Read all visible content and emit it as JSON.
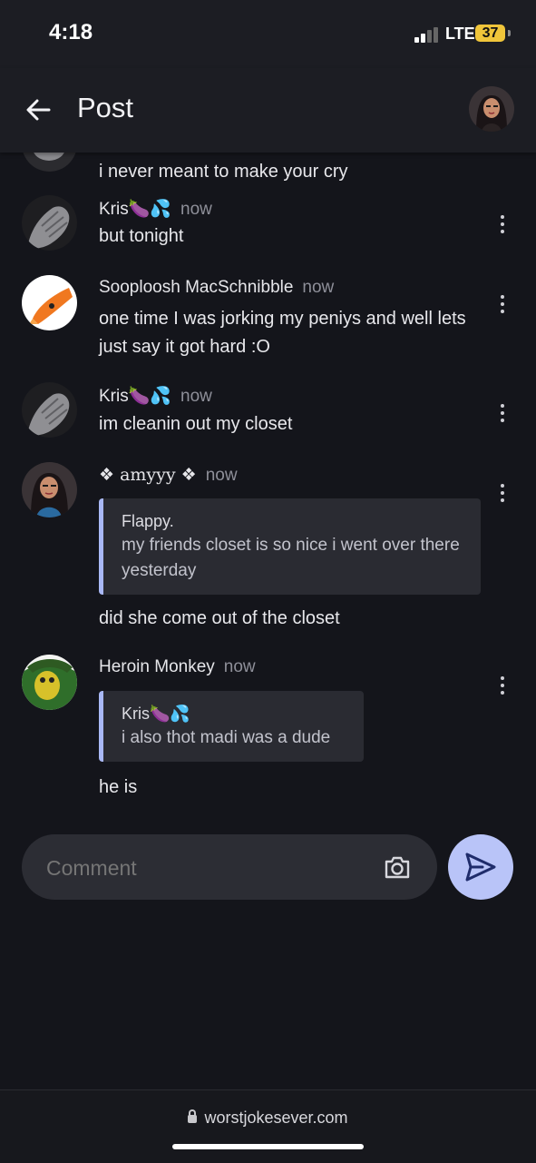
{
  "status": {
    "time": "4:18",
    "network": "LTE",
    "battery": "37"
  },
  "header": {
    "title": "Post"
  },
  "partial_comment": {
    "text": "i never meant to make your cry"
  },
  "comments": [
    {
      "author": "Kris🍆💦",
      "time": "now",
      "text": "but tonight"
    },
    {
      "author": "Sooploosh MacSchnibble",
      "time": "now",
      "text": "one time I was jorking my peniys and well lets just say it got hard :O"
    },
    {
      "author": "Kris🍆💦",
      "time": "now",
      "text": "im cleanin out my closet"
    },
    {
      "author": "❖ amyyy ❖",
      "time": "now",
      "quote": {
        "author": "Flappy.",
        "text": "my friends closet is so nice i went over there yesterday"
      },
      "text": "did she come out of the closet"
    },
    {
      "author": "Heroin Monkey",
      "time": "now",
      "quote": {
        "author": "Kris🍆💦",
        "text": "i also thot madi was a dude"
      },
      "text": "he is"
    }
  ],
  "composer": {
    "placeholder": "Comment"
  },
  "browser": {
    "url": "worstjokesever.com"
  },
  "colors": {
    "background": "#14151b",
    "accent": "#b9c4f8",
    "quote_bar": "#a9b8f5"
  },
  "icons": [
    "back-arrow-icon",
    "camera-icon",
    "send-icon",
    "more-vert-icon",
    "lock-icon"
  ]
}
